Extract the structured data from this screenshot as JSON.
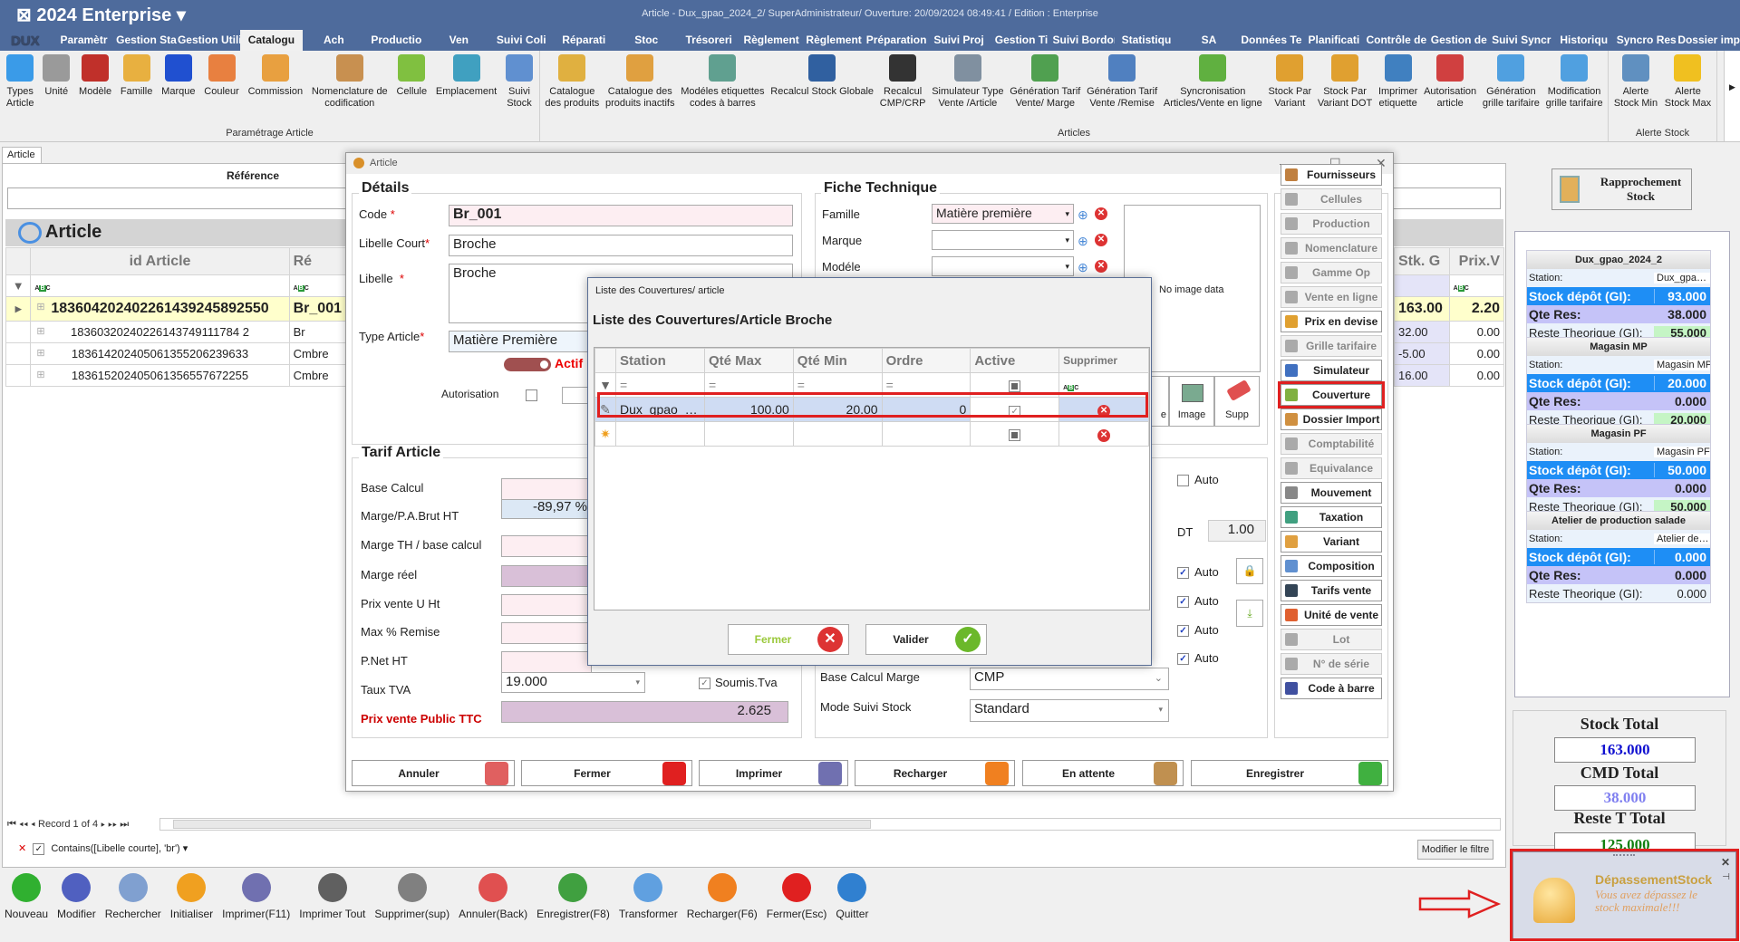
{
  "app": {
    "title": "⊠ 2024  Enterprise  ▾",
    "window_title": "Article - Dux_gpao_2024_2/ SuperAdministrateur/ Ouverture: 20/09/2024 08:49:41 / Edition : Enterprise",
    "logo": "DUX"
  },
  "menu": [
    "Paramètr",
    "Gestion Sta",
    "Gestion Utili",
    "Catalogu",
    "Ach",
    "Productio",
    "Ven",
    "Suivi Coli",
    "Réparati",
    "Stoc",
    "Trésoreri",
    "Règlement",
    "Règlement",
    "Préparation",
    "Suivi Proj",
    "Gestion Ti",
    "Suivi Bordor",
    "Statistiqu",
    "SA",
    "Données Te",
    "Planificati",
    "Contrôle de",
    "Gestion de",
    "Suivi Syncr",
    "Historiqu",
    "Syncro Res",
    "Dossier imp"
  ],
  "menu_active": "Catalogu",
  "ribbon": [
    {
      "label": "Paramétrage Article",
      "items": [
        {
          "label": "Types\nArticle",
          "icon": "cubes-icon",
          "color": "#3a9be8"
        },
        {
          "label": "Unité",
          "icon": "gears-icon",
          "color": "#9a9a9a"
        },
        {
          "label": "Modèle",
          "icon": "dice-icon",
          "color": "#c0302a"
        },
        {
          "label": "Famille",
          "icon": "hierarchy-icon",
          "color": "#e8b040"
        },
        {
          "label": "Marque",
          "icon": "refresh-arrows-icon",
          "color": "#2050d0"
        },
        {
          "label": "Couleur",
          "icon": "palette-icon",
          "color": "#e88040"
        },
        {
          "label": "Commission",
          "icon": "inbox-icon",
          "color": "#e8a040"
        },
        {
          "label": "Nomenclature de\ncodification",
          "icon": "box-icon",
          "color": "#c89050"
        },
        {
          "label": "Cellule",
          "icon": "cells-icon",
          "color": "#80c040"
        },
        {
          "label": "Emplacement",
          "icon": "map-icon",
          "color": "#40a0c0"
        },
        {
          "label": "Suivi\nStock",
          "icon": "stock-doc-icon",
          "color": "#6090d0"
        }
      ]
    },
    {
      "label": "Articles",
      "items": [
        {
          "label": "Catalogue\ndes produits",
          "icon": "boxes-icon",
          "color": "#e0b040"
        },
        {
          "label": "Catalogue des\nproduits inactifs",
          "icon": "db-delete-icon",
          "color": "#e0a040"
        },
        {
          "label": "Modéles etiquettes\ncodes à barres",
          "icon": "barcode-icon",
          "color": "#60a090"
        },
        {
          "label": "Recalcul Stock Globale",
          "icon": "tag-icon",
          "color": "#3060a0"
        },
        {
          "label": "Recalcul\nCMP/CRP",
          "icon": "coins-icon",
          "color": "#333333"
        },
        {
          "label": "Simulateur Type\nVente /Article",
          "icon": "selection-icon",
          "color": "#8090a0"
        },
        {
          "label": "Génération Tarif\nVente/ Marge",
          "icon": "percent-sheet-icon",
          "color": "#50a050"
        },
        {
          "label": "Génération Tarif\nVente /Remise",
          "icon": "percent-sheet-icon",
          "color": "#5080c0"
        },
        {
          "label": "Syncronisation\nArticles/Vente en ligne",
          "icon": "sync-icon",
          "color": "#60b040"
        },
        {
          "label": "Stock Par\nVariant",
          "icon": "database-icon",
          "color": "#e0a030"
        },
        {
          "label": "Stock Par\nVariant DOT",
          "icon": "database-delete-icon",
          "color": "#e0a030"
        },
        {
          "label": "Imprimer\netiquette",
          "icon": "printer-icon",
          "color": "#4080c0"
        },
        {
          "label": "Autorisation\narticle",
          "icon": "document-icon",
          "color": "#d04040"
        },
        {
          "label": "Génération\ngrille tarifaire",
          "icon": "export-icon",
          "color": "#50a0e0"
        },
        {
          "label": "Modification\ngrille tarifaire",
          "icon": "download-icon",
          "color": "#50a0e0"
        }
      ]
    },
    {
      "label": "Alerte Stock",
      "items": [
        {
          "label": "Alerte\nStock Min",
          "icon": "megaphone-icon",
          "color": "#6090c0"
        },
        {
          "label": "Alerte\nStock Max",
          "icon": "bulb-icon",
          "color": "#f0c020"
        }
      ]
    }
  ],
  "left": {
    "tab": "Article",
    "reference_label": "Référence",
    "grid_title": "Article",
    "columns": [
      "id Article",
      "Ré"
    ],
    "right_columns": [
      "Stk. G",
      "Prix.V"
    ],
    "rows": [
      {
        "id": "183604202402261439245892550",
        "ref": "Br_001",
        "stk": "163.00",
        "prix": "2.20"
      },
      {
        "id": "18360320240226143749111784 2",
        "ref": "Br",
        "stk": "32.00",
        "prix": "0.00"
      },
      {
        "id": "183614202405061355206239633",
        "ref": "Cmbre",
        "stk": "-5.00",
        "prix": "0.00"
      },
      {
        "id": "183615202405061356557672255",
        "ref": "Cmbre",
        "stk": "16.00",
        "prix": "0.00"
      }
    ],
    "record_nav": "Record 1 of 4",
    "filter": "Contains([Libelle courte], 'br')",
    "modify_filter": "Modifier le filtre"
  },
  "bottom_toolbar": [
    {
      "label": "Nouveau",
      "icon": "plus-circle-icon",
      "color": "#30b030"
    },
    {
      "label": "Modifier",
      "icon": "edit-icon",
      "color": "#5060c0"
    },
    {
      "label": "Rechercher",
      "icon": "search-icon",
      "color": "#80a0d0"
    },
    {
      "label": "Initialiser",
      "icon": "reset-icon",
      "color": "#f0a020"
    },
    {
      "label": "Imprimer(F11)",
      "icon": "printer-icon",
      "color": "#7070b0"
    },
    {
      "label": "Imprimer Tout",
      "icon": "printer-all-icon",
      "color": "#606060"
    },
    {
      "label": "Supprimer(sup)",
      "icon": "trash-icon",
      "color": "#808080"
    },
    {
      "label": "Annuler(Back)",
      "icon": "undo-icon",
      "color": "#e05050"
    },
    {
      "label": "Enregistrer(F8)",
      "icon": "save-icon",
      "color": "#40a040"
    },
    {
      "label": "Transformer",
      "icon": "transform-icon",
      "color": "#60a0e0"
    },
    {
      "label": "Recharger(F6)",
      "icon": "reload-icon",
      "color": "#f08020"
    },
    {
      "label": "Fermer(Esc)",
      "icon": "close-icon",
      "color": "#e02020"
    },
    {
      "label": "Quitter",
      "icon": "power-icon",
      "color": "#3080d0"
    }
  ],
  "dialog": {
    "title": "Article",
    "details": {
      "title": "Détails",
      "code_label": "Code",
      "code": "Br_001",
      "libelle_court_label": "Libelle Court",
      "libelle_court": "Broche",
      "libelle_label": "Libelle",
      "libelle": "Broche",
      "type_label": "Type Article",
      "type": "Matière Première",
      "actif": "Actif",
      "autorisation": "Autorisation",
      "required": "*"
    },
    "fiche": {
      "title": "Fiche Technique",
      "famille_label": "Famille",
      "famille": "Matière première",
      "marque_label": "Marque",
      "modele_label": "Modéle",
      "no_image": "No image data",
      "image_btn": "Image",
      "supp_btn": "Supp",
      "image_btn_partial": "e"
    },
    "tarif": {
      "title": "Tarif Article",
      "labels": [
        "Base Calcul",
        "Marge/P.A.Brut HT",
        "Marge TH / base calcul",
        "Marge réel",
        "Prix vente U Ht",
        "Max % Remise",
        "P.Net HT",
        "Taux TVA",
        "Prix vente Public TTC"
      ],
      "marge_pa": "-89,97 %",
      "taux_tva": "19.000",
      "soumis_tva": "Soumis.Tva",
      "prix_ttc": "2.625",
      "auto": "Auto",
      "dt_label": "DT",
      "dt": "1.00",
      "base_calcul_marge_label": "Base Calcul Marge",
      "base_calcul_marge": "CMP",
      "mode_suivi_label": "Mode Suivi Stock",
      "mode_suivi": "Standard"
    },
    "side_buttons": [
      {
        "label": "Fournisseurs",
        "enabled": true,
        "icon": "suppliers-icon",
        "color": "#c08040"
      },
      {
        "label": "Cellules",
        "enabled": false,
        "icon": "bars-icon",
        "color": "#aaaaaa"
      },
      {
        "label": "Production",
        "enabled": false,
        "icon": "production-icon",
        "color": "#aaaaaa"
      },
      {
        "label": "Nomenclature",
        "enabled": false,
        "icon": "list-icon",
        "color": "#aaaaaa"
      },
      {
        "label": "Gamme Op",
        "enabled": false,
        "icon": "window-icon",
        "color": "#aaaaaa"
      },
      {
        "label": "Vente en ligne",
        "enabled": false,
        "icon": "cart-icon",
        "color": "#aaaaaa"
      },
      {
        "label": "Prix en devise",
        "enabled": true,
        "icon": "currency-icon",
        "color": "#e0a030"
      },
      {
        "label": "Grille tarifaire",
        "enabled": false,
        "icon": "grid-plus-icon",
        "color": "#aaaaaa"
      },
      {
        "label": "Simulateur",
        "enabled": true,
        "icon": "calculator-icon",
        "color": "#4070c0"
      },
      {
        "label": "Couverture",
        "enabled": true,
        "icon": "coverage-icon",
        "color": "#80b040",
        "highlight": true
      },
      {
        "label": "Dossier Import",
        "enabled": true,
        "icon": "package-icon",
        "color": "#d09040"
      },
      {
        "label": "Comptabilité",
        "enabled": false,
        "icon": "numbers-icon",
        "color": "#aaaaaa"
      },
      {
        "label": "Equivalance",
        "enabled": false,
        "icon": "equivalence-icon",
        "color": "#aaaaaa"
      },
      {
        "label": "Mouvement",
        "enabled": true,
        "icon": "list-lines-icon",
        "color": "#888888"
      },
      {
        "label": "Taxation",
        "enabled": true,
        "icon": "tax-tag-icon",
        "color": "#40a080"
      },
      {
        "label": "Variant",
        "enabled": true,
        "icon": "variant-icon",
        "color": "#e0a040"
      },
      {
        "label": "Composition",
        "enabled": true,
        "icon": "composition-icon",
        "color": "#6090d0"
      },
      {
        "label": "Tarifs vente",
        "enabled": true,
        "icon": "percent-icon",
        "color": "#334455"
      },
      {
        "label": "Unité de vente",
        "enabled": true,
        "icon": "sale-unit-icon",
        "color": "#e06030"
      },
      {
        "label": "Lot",
        "enabled": false,
        "icon": "lot-icon",
        "color": "#aaaaaa"
      },
      {
        "label": "N° de série",
        "enabled": false,
        "icon": "numbered-list-icon",
        "color": "#aaaaaa"
      },
      {
        "label": "Code à barre",
        "enabled": true,
        "icon": "barcode-icon",
        "color": "#4050a0"
      }
    ],
    "buttons": [
      {
        "label": "Annuler",
        "icon": "undo-icon",
        "color": "#e06060"
      },
      {
        "label": "Fermer",
        "icon": "close-icon",
        "color": "#e02020"
      },
      {
        "label": "Imprimer",
        "icon": "printer-icon",
        "color": "#7070b0"
      },
      {
        "label": "Recharger",
        "icon": "reload-icon",
        "color": "#f08020"
      },
      {
        "label": "En attente",
        "icon": "pending-box-icon",
        "color": "#c09050"
      },
      {
        "label": "Enregistrer",
        "icon": "save-icon",
        "color": "#40b040"
      }
    ]
  },
  "couverture": {
    "window_title": "Liste des Couvertures/ article",
    "title": "Liste des Couvertures/Article Broche",
    "columns": [
      "Station",
      "Qté Max",
      "Qté Min",
      "Ordre",
      "Active",
      "Supprimer"
    ],
    "rows": [
      {
        "station": "Dux_gpao_…",
        "qte_max": "100.00",
        "qte_min": "20.00",
        "ordre": "0",
        "active": true
      }
    ],
    "fermer": "Fermer",
    "valider": "Valider"
  },
  "right_panel": {
    "rapprochement": "Rapprochement Stock",
    "labels": {
      "station": "Station:",
      "stock": "Stock dépôt (GI):",
      "qte_res": "Qte Res:",
      "reste": "Reste Theorique (GI):"
    },
    "depots": [
      {
        "name": "Dux_gpao_2024_2",
        "station": "Dux_gpa…",
        "stock": "93.000",
        "qte_res": "38.000",
        "reste": "55.000"
      },
      {
        "name": "Magasin MP",
        "station": "Magasin MP",
        "stock": "20.000",
        "qte_res": "0.000",
        "reste": "20.000"
      },
      {
        "name": "Magasin PF",
        "station": "Magasin PF",
        "stock": "50.000",
        "qte_res": "0.000",
        "reste": "50.000"
      },
      {
        "name": "Atelier de production salade",
        "station": "Atelier de…",
        "stock": "0.000",
        "qte_res": "0.000",
        "reste": "0.000"
      }
    ],
    "stock_total_label": "Stock Total",
    "stock_total": "163.000",
    "cmd_total_label": "CMD Total",
    "cmd_total": "38.000",
    "reste_total_label": "Reste T Total",
    "reste_total": "125.000"
  },
  "notification": {
    "title": "DépassementStock",
    "message": "Vous avez dépassez le stock maximale!!!",
    "icon": "bell-icon"
  },
  "colors": {
    "title_bar": "#4e6b9c",
    "highlight": "#e02020",
    "stock_blue": "#1e8ef5",
    "qte_purple": "#c5c3f8",
    "reste_green": "#c5f5c5"
  }
}
